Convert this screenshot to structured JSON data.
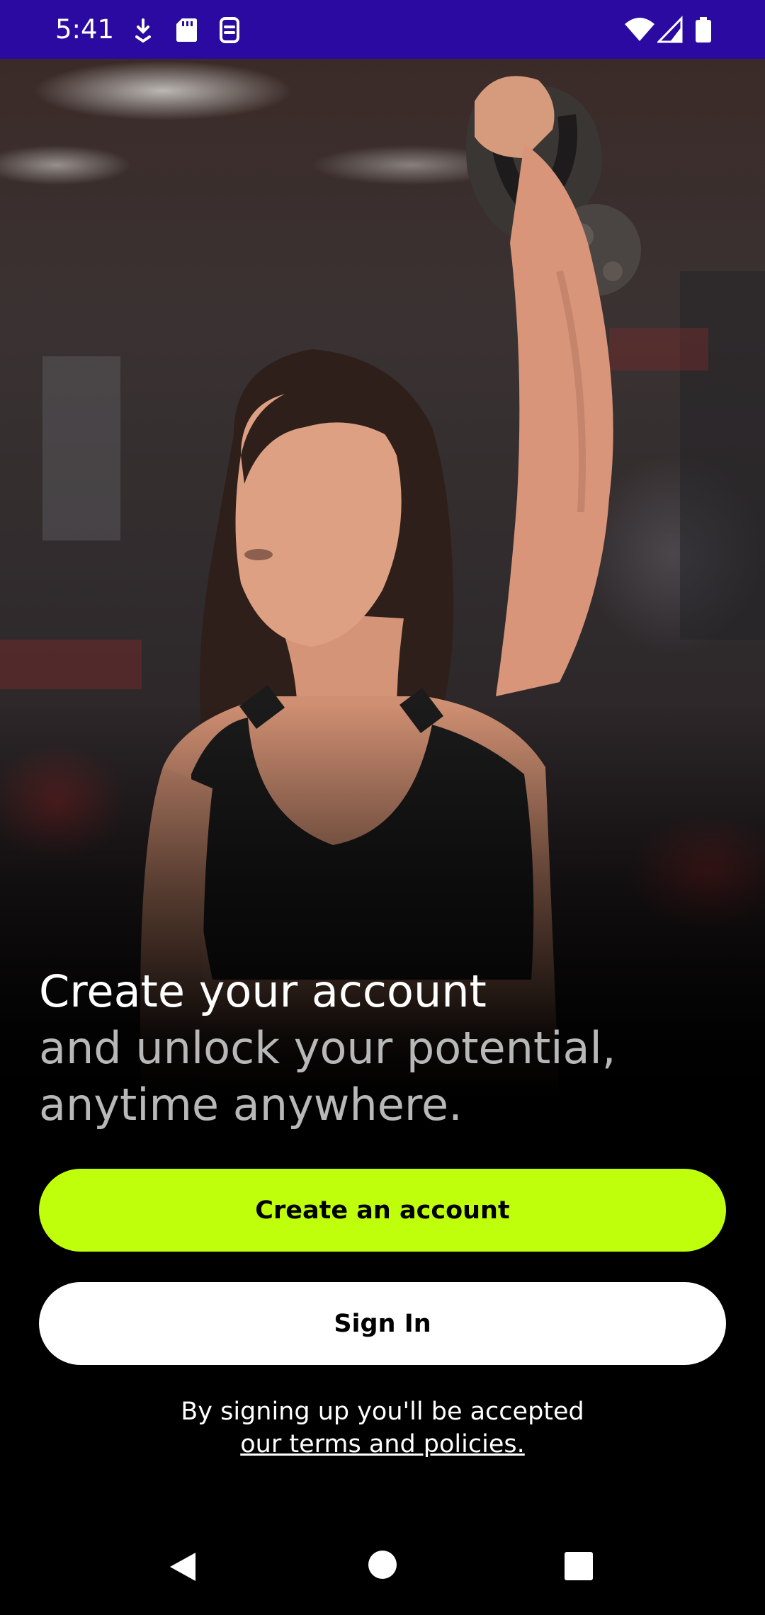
{
  "status_bar": {
    "time": "5:41",
    "left_icons": [
      "download-notification-icon",
      "sd-card-icon",
      "sync-notification-icon"
    ],
    "right_icons": [
      "wifi-icon",
      "cell-signal-icon",
      "battery-icon"
    ]
  },
  "hero": {
    "image_icon": "gym-woman-kettlebell-photo"
  },
  "headline": {
    "title": "Create your account",
    "subtitle": "and unlock your potential, anytime anywhere."
  },
  "buttons": {
    "create_account": "Create an account",
    "sign_in": "Sign In"
  },
  "legal": {
    "text": "By signing up you'll be accepted",
    "link": "our terms and policies."
  },
  "nav_bar": {
    "icons": [
      "back-icon",
      "home-icon",
      "recents-icon"
    ]
  },
  "colors": {
    "status_bar": "#2a0aa0",
    "primary_button": "#c0ff0c",
    "secondary_button": "#ffffff",
    "background": "#000000"
  }
}
